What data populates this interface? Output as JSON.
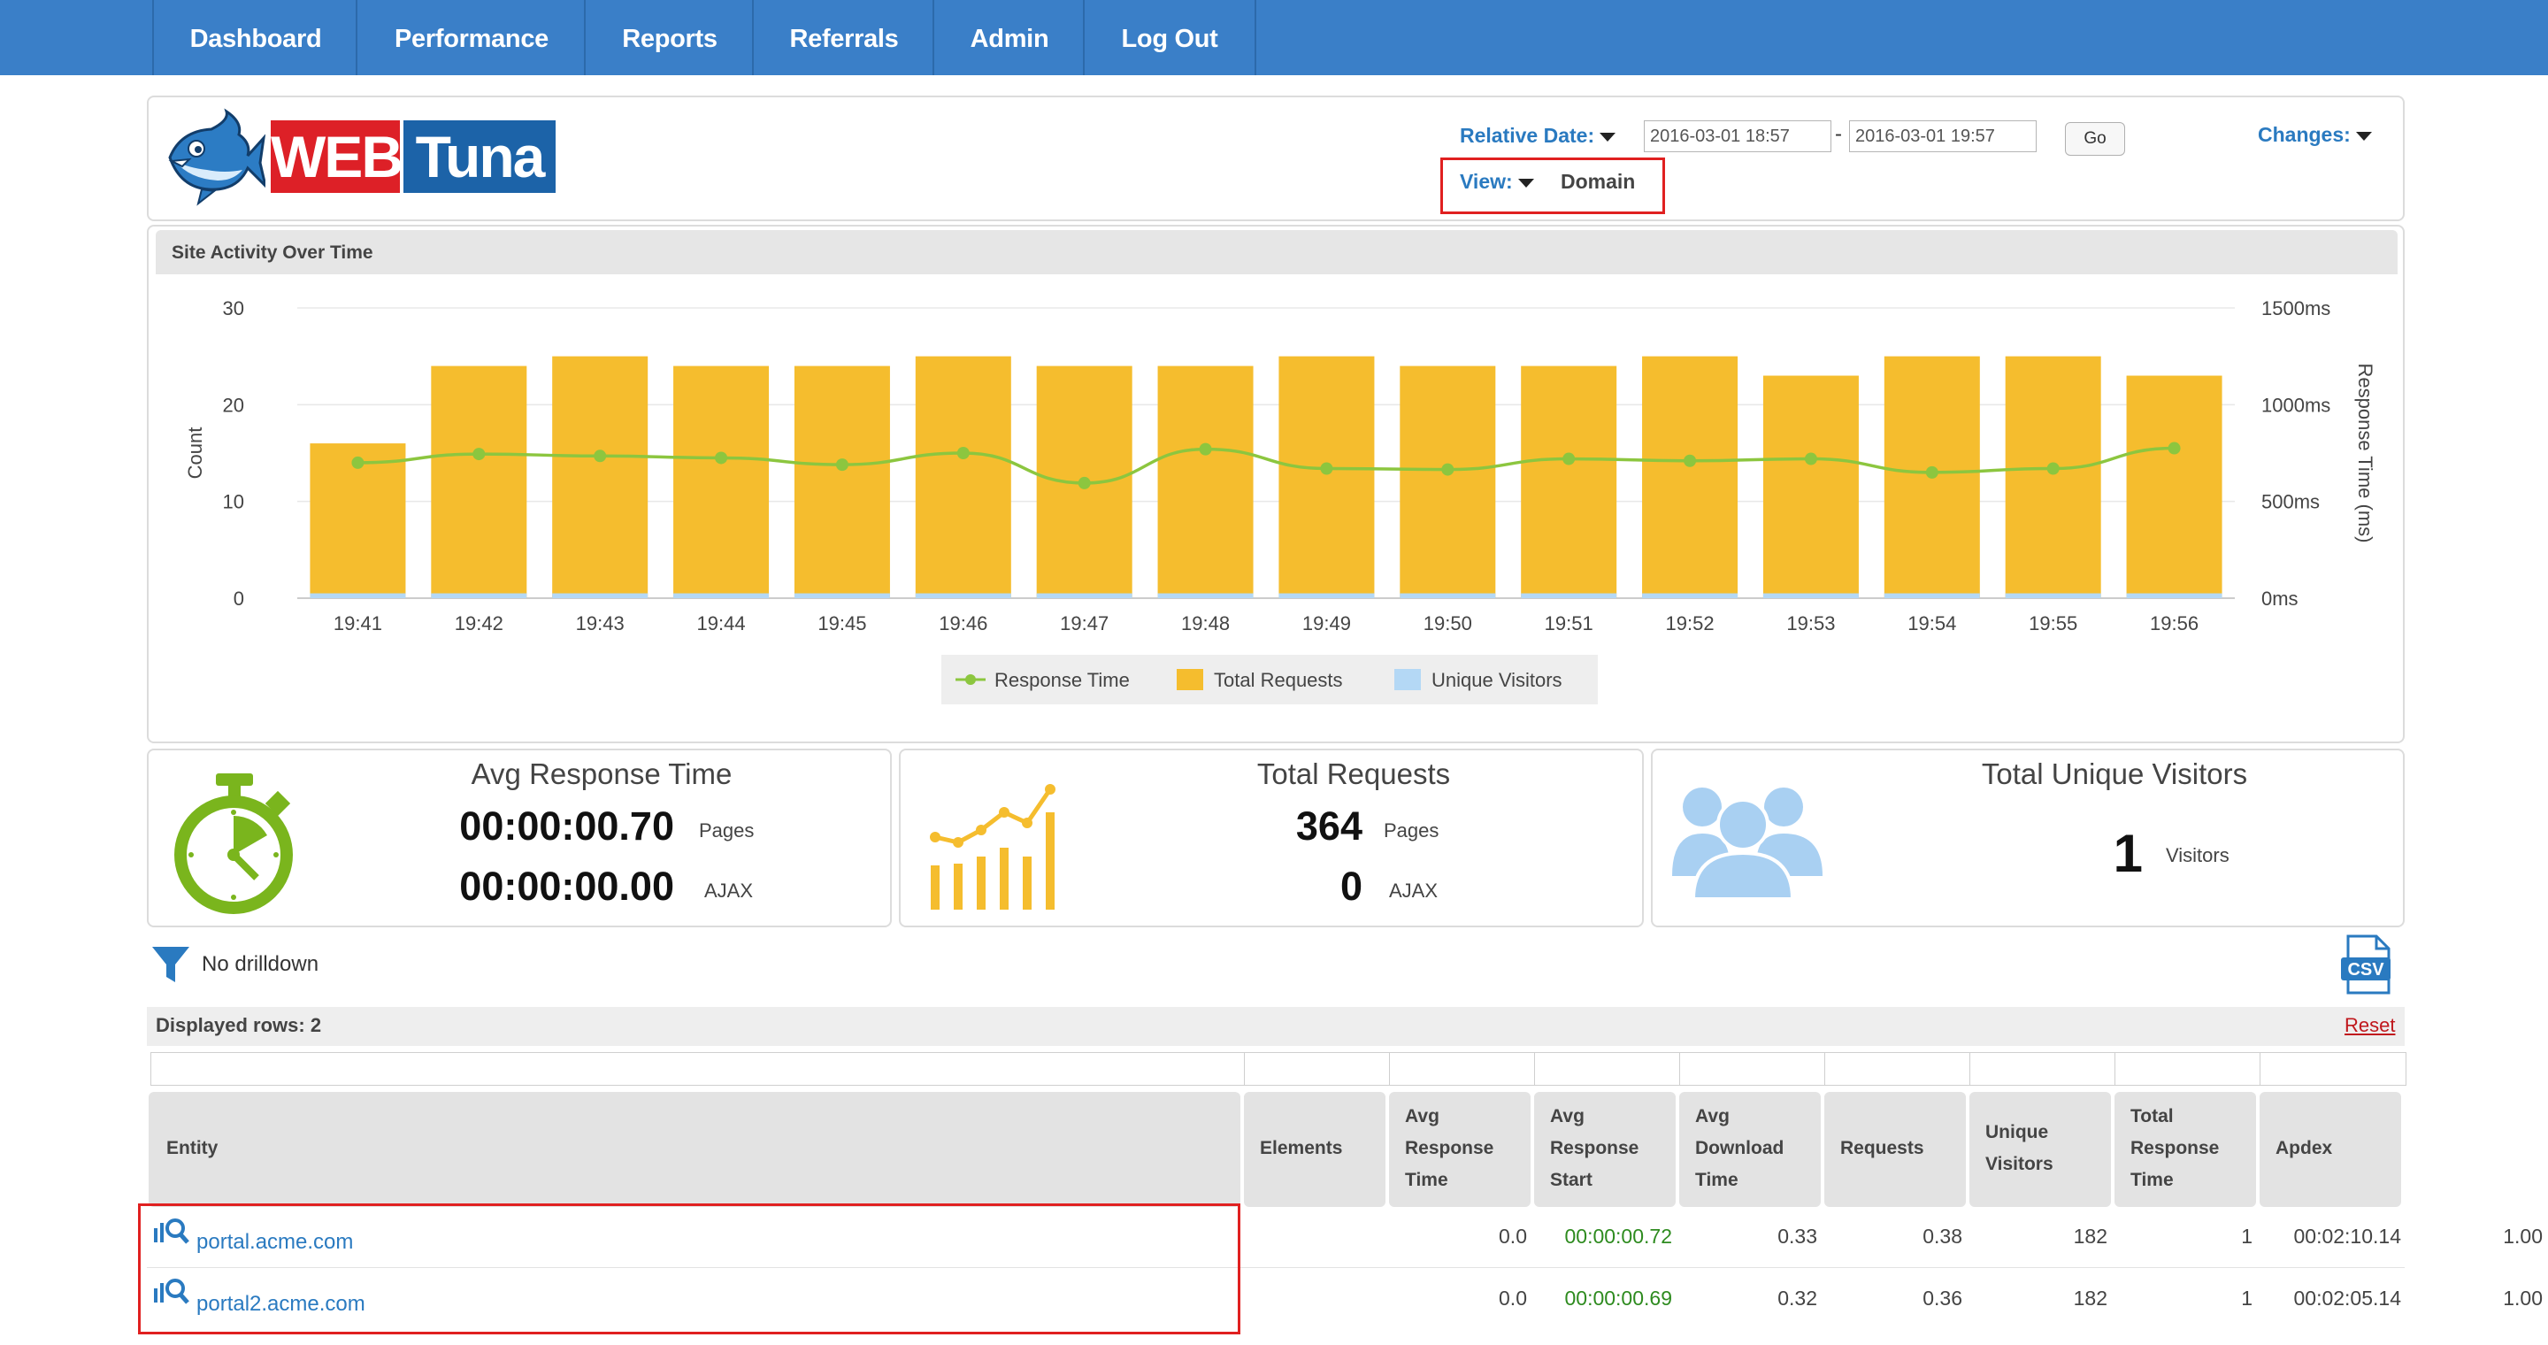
{
  "nav": {
    "items": [
      "Dashboard",
      "Performance",
      "Reports",
      "Referrals",
      "Admin",
      "Log Out"
    ]
  },
  "header": {
    "logo_word1": "WEB",
    "logo_word2": "Tuna",
    "relative_date_label": "Relative Date:",
    "date_from": "2016-03-01 18:57",
    "date_separator": "-",
    "date_to": "2016-03-01 19:57",
    "go_label": "Go",
    "changes_label": "Changes:",
    "view_label": "View:",
    "view_value": "Domain"
  },
  "chart_panel": {
    "title": "Site Activity Over Time"
  },
  "chart_data": {
    "type": "bar",
    "categories": [
      "19:41",
      "19:42",
      "19:43",
      "19:44",
      "19:45",
      "19:46",
      "19:47",
      "19:48",
      "19:49",
      "19:50",
      "19:51",
      "19:52",
      "19:53",
      "19:54",
      "19:55",
      "19:56"
    ],
    "series": [
      {
        "name": "Total Requests",
        "type": "bar",
        "axis": "left",
        "color": "#f5bd2e",
        "values": [
          16,
          24,
          25,
          24,
          24,
          25,
          24,
          24,
          25,
          24,
          24,
          25,
          23,
          25,
          25,
          23
        ]
      },
      {
        "name": "Unique Visitors",
        "type": "bar",
        "axis": "left",
        "color": "#b4d8f5",
        "values": [
          1,
          1,
          1,
          1,
          1,
          1,
          1,
          1,
          1,
          1,
          1,
          1,
          1,
          1,
          1,
          1
        ]
      },
      {
        "name": "Response Time",
        "type": "line",
        "axis": "right",
        "color": "#8cc63f",
        "values": [
          700,
          745,
          735,
          725,
          690,
          750,
          595,
          770,
          670,
          665,
          720,
          710,
          720,
          650,
          670,
          775
        ]
      }
    ],
    "ylabel": "Count",
    "ylim": [
      0,
      30
    ],
    "yticks": [
      "0",
      "10",
      "20",
      "30"
    ],
    "y2label": "Response Time (ms)",
    "y2lim": [
      0,
      1500
    ],
    "y2ticks": [
      "0ms",
      "500ms",
      "1000ms",
      "1500ms"
    ],
    "legend": [
      "Response Time",
      "Total Requests",
      "Unique Visitors"
    ],
    "legend_position": "bottom",
    "grid": "horizontal"
  },
  "stats": {
    "response": {
      "title": "Avg Response Time",
      "pages_value": "00:00:00.70",
      "pages_label": "Pages",
      "ajax_value": "00:00:00.00",
      "ajax_label": "AJAX"
    },
    "requests": {
      "title": "Total Requests",
      "pages_value": "364",
      "pages_label": "Pages",
      "ajax_value": "0",
      "ajax_label": "AJAX"
    },
    "visitors": {
      "title": "Total Unique Visitors",
      "value": "1",
      "label": "Visitors"
    }
  },
  "filter": {
    "drilldown_text": "No drilldown",
    "csv_label": "CSV"
  },
  "table": {
    "displayed_rows_text": "Displayed rows: 2",
    "reset_label": "Reset",
    "headers": [
      "Entity",
      "Elements",
      "Avg Response Time",
      "Avg Response Start",
      "Avg Download Time",
      "Requests",
      "Unique Visitors",
      "Total Response Time",
      "Apdex"
    ],
    "header_lines": [
      [
        "Entity"
      ],
      [
        "Elements"
      ],
      [
        "Avg",
        "Response",
        "Time"
      ],
      [
        "Avg",
        "Response",
        "Start"
      ],
      [
        "Avg",
        "Download",
        "Time"
      ],
      [
        "Requests"
      ],
      [
        "Unique",
        "Visitors"
      ],
      [
        "Total",
        "Response",
        "Time"
      ],
      [
        "Apdex"
      ]
    ],
    "rows": [
      {
        "entity": "portal.acme.com",
        "elements": "0.0",
        "avg_response_time": "00:00:00.72",
        "avg_response_start": "0.33",
        "avg_download_time": "0.38",
        "requests": "182",
        "unique_visitors": "1",
        "total_response_time": "00:02:10.14",
        "apdex": "1.00"
      },
      {
        "entity": "portal2.acme.com",
        "elements": "0.0",
        "avg_response_time": "00:00:00.69",
        "avg_response_start": "0.32",
        "avg_download_time": "0.36",
        "requests": "182",
        "unique_visitors": "1",
        "total_response_time": "00:02:05.14",
        "apdex": "1.00"
      }
    ]
  },
  "colors": {
    "nav_bg": "#3a7fc8",
    "link": "#2a7ac0",
    "bar": "#f5bd2e",
    "visitors": "#b4d8f5",
    "line": "#8cc63f",
    "highlight": "#e02020",
    "response_value": "#2e8b1f"
  }
}
